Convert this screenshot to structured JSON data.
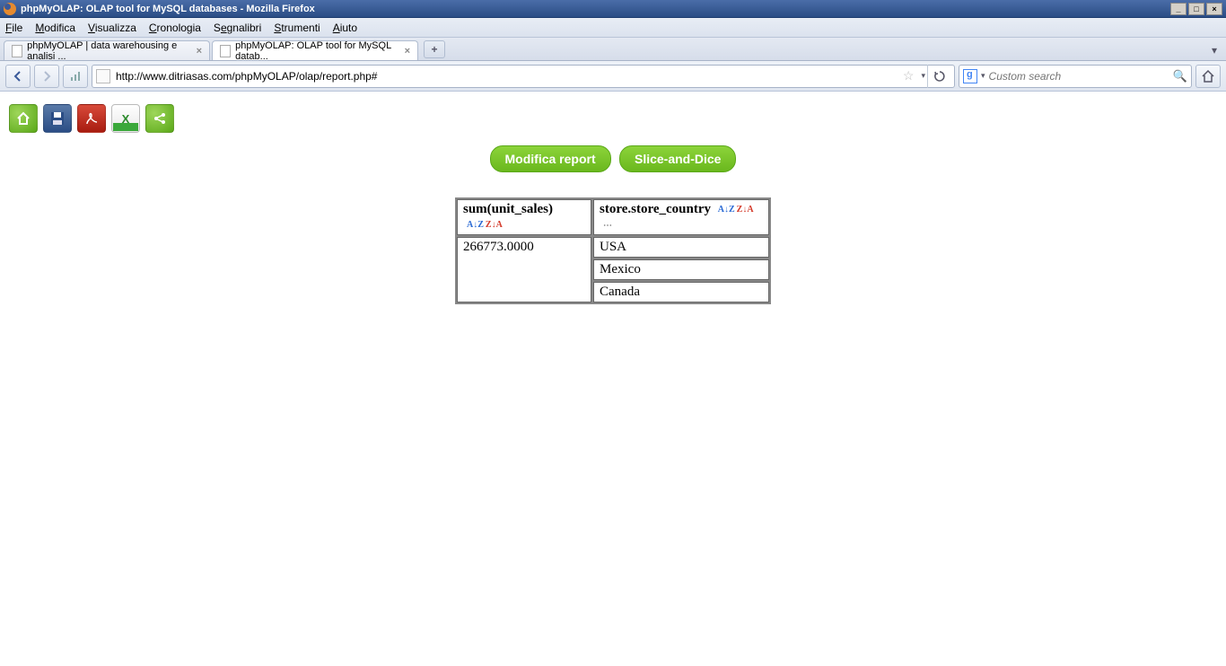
{
  "window": {
    "title": "phpMyOLAP: OLAP tool for MySQL databases - Mozilla Firefox"
  },
  "menubar": {
    "items": [
      "File",
      "Modifica",
      "Visualizza",
      "Cronologia",
      "Segnalibri",
      "Strumenti",
      "Aiuto"
    ]
  },
  "tabs": {
    "items": [
      {
        "label": "phpMyOLAP | data warehousing e analisi ...",
        "active": false
      },
      {
        "label": "phpMyOLAP: OLAP tool for MySQL datab...",
        "active": true
      }
    ]
  },
  "url": "http://www.ditriasas.com/phpMyOLAP/olap/report.php#",
  "search": {
    "placeholder": "Custom search"
  },
  "toolbar": {
    "home": "⌂",
    "save": "💾",
    "pdf": "PDF",
    "xls": "X",
    "share": "↗"
  },
  "actions": {
    "modify": "Modifica report",
    "slice": "Slice-and-Dice"
  },
  "olap": {
    "measure_header": "sum(unit_sales)",
    "dimension_header": "store.store_country",
    "measure_value": "266773.0000",
    "rows": [
      "USA",
      "Mexico",
      "Canada"
    ],
    "sort_az": "A↓Z",
    "sort_za": "Z↓A",
    "detail": "⋯"
  }
}
